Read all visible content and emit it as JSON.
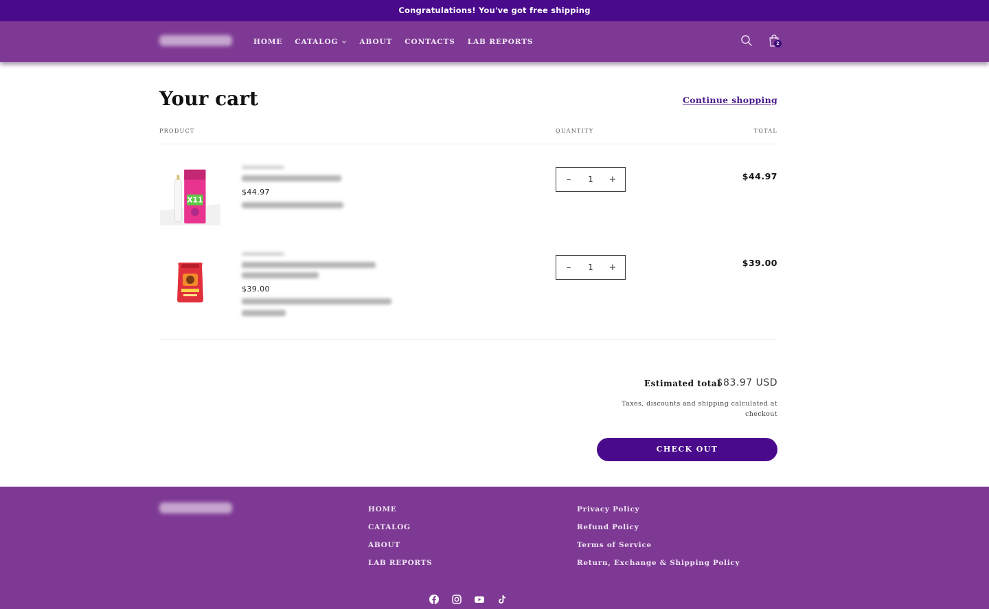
{
  "announcement": "Congratulations! You've got free shipping",
  "header": {
    "nav": [
      "HOME",
      "CATALOG",
      "ABOUT",
      "CONTACTS",
      "LAB REPORTS"
    ],
    "cart_count": "2"
  },
  "cart": {
    "title": "Your cart",
    "continue_label": "Continue shopping",
    "columns": {
      "product": "PRODUCT",
      "quantity": "QUANTITY",
      "total": "TOTAL"
    },
    "items": [
      {
        "price": "$44.97",
        "quantity": "1",
        "total": "$44.97"
      },
      {
        "price": "$39.00",
        "quantity": "1",
        "total": "$39.00"
      }
    ],
    "estimated_label": "Estimated total",
    "estimated_value": "$83.97 USD",
    "tax_note": "Taxes, discounts and shipping calculated at checkout",
    "checkout_label": "CHECK OUT"
  },
  "footer": {
    "menu": [
      "HOME",
      "CATALOG",
      "ABOUT",
      "LAB REPORTS"
    ],
    "policies": [
      "Privacy Policy",
      "Refund Policy",
      "Terms of Service",
      "Return, Exchange & Shipping Policy"
    ],
    "social_icons": [
      "facebook-icon",
      "instagram-icon",
      "youtube-icon",
      "tiktok-icon"
    ]
  },
  "colors": {
    "brand_purple": "#7e3994",
    "deep_purple": "#4a0a8c"
  }
}
